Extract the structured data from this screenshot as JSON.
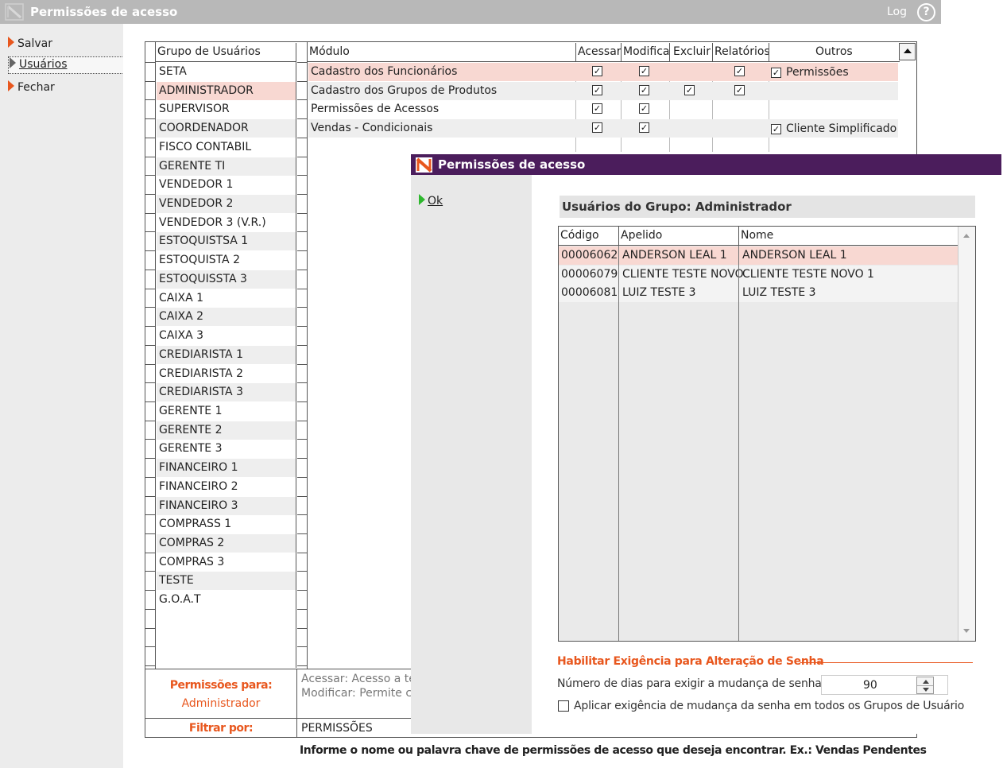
{
  "window": {
    "title": "Permissões de acesso",
    "log_label": "Log",
    "help_label": "?"
  },
  "nav": {
    "items": [
      {
        "label": "Salvar"
      },
      {
        "label": "Usuários"
      },
      {
        "label": "Fechar"
      }
    ]
  },
  "groups": {
    "header": "Grupo de Usuários",
    "items": [
      "SETA",
      "ADMINISTRADOR",
      "SUPERVISOR",
      "COORDENADOR",
      "FISCO CONTABIL",
      "GERENTE TI",
      "VENDEDOR 1",
      "VENDEDOR 2",
      "VENDEDOR 3 (V.R.)",
      "ESTOQUISTSA 1",
      "ESTOQUISTA 2",
      "ESTOQUISSTA 3",
      "CAIXA 1",
      "CAIXA 2",
      "CAIXA 3",
      "CREDIARISTA 1",
      "CREDIARISTA 2",
      "CREDIARISTA 3",
      "GERENTE 1",
      "GERENTE 2",
      "GERENTE 3",
      "FINANCEIRO 1",
      "FINANCEIRO 2",
      "FINANCEIRO 3",
      "COMPRASS 1",
      "COMPRAS 2",
      "COMPRAS 3",
      "TESTE",
      "G.O.A.T"
    ],
    "selected": "ADMINISTRADOR"
  },
  "modules": {
    "headers": {
      "modulo": "Módulo",
      "acessar": "Acessar",
      "modificar": "Modifica",
      "excluir": "Excluir",
      "relatorios": "Relatórios",
      "outros": "Outros"
    },
    "rows": [
      {
        "name": "Cadastro dos Funcionários",
        "acessar": true,
        "modificar": true,
        "excluir": false,
        "relatorios": true,
        "outros_checked": true,
        "outros_label": "Permissões"
      },
      {
        "name": "Cadastro dos Grupos de Produtos",
        "acessar": true,
        "modificar": true,
        "excluir": true,
        "relatorios": true,
        "outros_checked": false,
        "outros_label": ""
      },
      {
        "name": "Permissões de Acessos",
        "acessar": true,
        "modificar": true,
        "excluir": false,
        "relatorios": false,
        "outros_checked": false,
        "outros_label": ""
      },
      {
        "name": "Vendas - Condicionais",
        "acessar": true,
        "modificar": true,
        "excluir": false,
        "relatorios": false,
        "outros_checked": true,
        "outros_label": "Cliente Simplificado"
      }
    ]
  },
  "bottom": {
    "perm_for_label": "Permissões para:",
    "perm_for_value": "Administrador",
    "legend_line1": "Acessar: Acesso a tela",
    "legend_line2": "Modificar: Permite cr",
    "filter_label": "Filtrar por:",
    "filter_value": "PERMISSÕES",
    "hint": "Informe o nome ou palavra chave de permissões de acesso que deseja encontrar. Ex.: Vendas Pendentes"
  },
  "dialog": {
    "title": "Permissões de acesso",
    "ok_label": "Ok",
    "users_title": "Usuários do Grupo: Administrador",
    "columns": {
      "codigo": "Código",
      "apelido": "Apelido",
      "nome": "Nome"
    },
    "users": [
      {
        "codigo": "00006062",
        "apelido": "ANDERSON LEAL 1",
        "nome": "ANDERSON LEAL 1"
      },
      {
        "codigo": "00006079",
        "apelido": "CLIENTE TESTE NOVO",
        "nome": "CLIENTE TESTE NOVO 1"
      },
      {
        "codigo": "00006081",
        "apelido": "LUIZ TESTE 3",
        "nome": "LUIZ TESTE 3"
      }
    ],
    "password_section_title": "Habilitar Exigência para Alteração de Senha",
    "days_label": "Número de dias para exigir a mudança de senha:",
    "days_value": "90",
    "apply_all_label": "Aplicar exigência de mudança da senha em todos os Grupos de Usuário",
    "apply_all_checked": false
  },
  "colors": {
    "accent": "#e8571e",
    "selection": "#f8d8d2",
    "dialog_titlebar": "#4b1d5c",
    "titlebar": "#b8b8b8"
  },
  "icons": [
    "app-logo-icon",
    "help-icon",
    "arrow-right-icon",
    "checkbox-icon",
    "scroll-up-icon",
    "scroll-down-icon",
    "spin-up-icon",
    "spin-down-icon"
  ]
}
